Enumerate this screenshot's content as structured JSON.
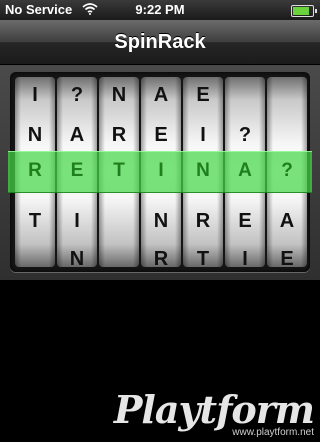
{
  "status_bar": {
    "carrier": "No Service",
    "wifi_icon": "wifi-icon",
    "time": "9:22 PM",
    "battery_icon": "battery-icon",
    "battery_level": 0.85
  },
  "nav": {
    "title": "SpinRack"
  },
  "wheels": [
    {
      "visible": [
        "I",
        "N",
        "R",
        "T",
        ""
      ]
    },
    {
      "visible": [
        "?",
        "A",
        "E",
        "I",
        "N"
      ]
    },
    {
      "visible": [
        "N",
        "R",
        "T",
        "",
        ""
      ]
    },
    {
      "visible": [
        "A",
        "E",
        "I",
        "N",
        "R"
      ]
    },
    {
      "visible": [
        "E",
        "I",
        "N",
        "R",
        "T"
      ]
    },
    {
      "visible": [
        "",
        "?",
        "A",
        "E",
        "I"
      ]
    },
    {
      "visible": [
        "",
        "",
        "?",
        "A",
        "E"
      ]
    }
  ],
  "watermark": {
    "logo": "Playtform",
    "url": "www.playtform.net"
  },
  "colors": {
    "highlight": "#46d746",
    "highlight_text": "#1f7f1f"
  }
}
